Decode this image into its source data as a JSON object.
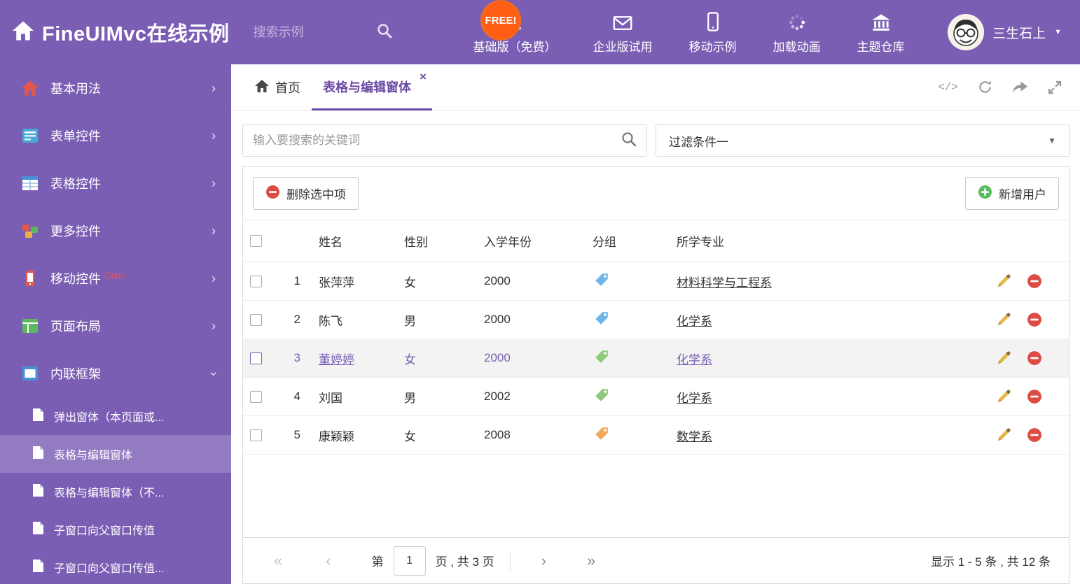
{
  "colors": {
    "theme_purple": "#7a5eb4",
    "active_purple": "#6b4aa5",
    "badge_orange": "#ff5e14",
    "danger_red": "#dd4b44",
    "success_green": "#5cb85c"
  },
  "icons": {
    "caret_down": "▼",
    "chevron": "›",
    "close": "×",
    "code": "</>"
  },
  "header": {
    "title": "FineUIMvc在线示例",
    "search_placeholder": "搜索示例",
    "free_badge": "FREE!",
    "nav": [
      {
        "label": "基础版（免费）",
        "icon": "download-icon"
      },
      {
        "label": "企业版试用",
        "icon": "envelope-icon"
      },
      {
        "label": "移动示例",
        "icon": "mobile-icon"
      },
      {
        "label": "加载动画",
        "icon": "spinner-icon"
      },
      {
        "label": "主题仓库",
        "icon": "bank-icon"
      }
    ],
    "user_name": "三生石上"
  },
  "sidebar": {
    "items": [
      {
        "label": "基本用法"
      },
      {
        "label": "表单控件"
      },
      {
        "label": "表格控件"
      },
      {
        "label": "更多控件"
      },
      {
        "label": "移动控件",
        "badge": "Corp."
      },
      {
        "label": "页面布局"
      },
      {
        "label": "内联框架"
      }
    ],
    "subitems": [
      {
        "label": "弹出窗体（本页面或..."
      },
      {
        "label": "表格与编辑窗体"
      },
      {
        "label": "表格与编辑窗体（不..."
      },
      {
        "label": "子窗口向父窗口传值"
      },
      {
        "label": "子窗口向父窗口传值..."
      }
    ]
  },
  "tabs": {
    "home": "首页",
    "active": "表格与编辑窗体"
  },
  "filters": {
    "search_placeholder": "输入要搜索的关键词",
    "filter_value": "过滤条件一"
  },
  "toolbar": {
    "delete_label": "删除选中项",
    "add_label": "新增用户"
  },
  "table": {
    "columns": {
      "name": "姓名",
      "gender": "性别",
      "year": "入学年份",
      "group": "分组",
      "major": "所学专业"
    },
    "rows": [
      {
        "num": "1",
        "name": "张萍萍",
        "gender": "女",
        "year": "2000",
        "tag_color": "#6fb5e8",
        "major": "材料科学与工程系"
      },
      {
        "num": "2",
        "name": "陈飞",
        "gender": "男",
        "year": "2000",
        "tag_color": "#6fb5e8",
        "major": "化学系"
      },
      {
        "num": "3",
        "name": "董婷婷",
        "gender": "女",
        "year": "2000",
        "tag_color": "#8fc97c",
        "major": "化学系"
      },
      {
        "num": "4",
        "name": "刘国",
        "gender": "男",
        "year": "2002",
        "tag_color": "#8fc97c",
        "major": "化学系"
      },
      {
        "num": "5",
        "name": "康颖颖",
        "gender": "女",
        "year": "2008",
        "tag_color": "#f2a65e",
        "major": "数学系"
      }
    ]
  },
  "pagination": {
    "first": "«",
    "prev": "‹",
    "next": "›",
    "last": "»",
    "page_label_before": "第",
    "page_value": "1",
    "page_label_after": "页 , 共 3 页",
    "summary": "显示 1 - 5 条 , 共 12 条"
  }
}
